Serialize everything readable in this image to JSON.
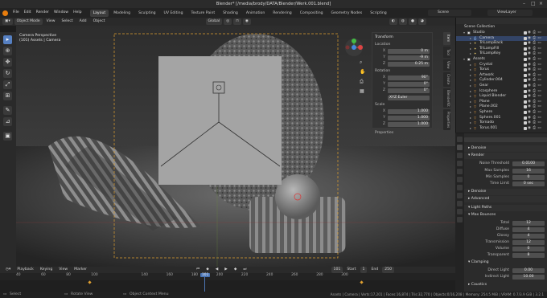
{
  "window": {
    "title": "Blender* [/media/brody/DATA/Blender/Werk.001.blend]"
  },
  "menu": [
    "File",
    "Edit",
    "Render",
    "Window",
    "Help"
  ],
  "workspaces": [
    "Layout",
    "Modeling",
    "Sculpting",
    "UV Editing",
    "Texture Paint",
    "Shading",
    "Animation",
    "Rendering",
    "Compositing",
    "Geometry Nodes",
    "Scripting"
  ],
  "active_workspace": "Layout",
  "scene": {
    "name": "Scene",
    "view_layer": "ViewLayer"
  },
  "header": {
    "mode": "Object Mode",
    "view": "View",
    "select": "Select",
    "add": "Add",
    "object": "Object",
    "orientation": "Global",
    "options": "Options"
  },
  "viewport": {
    "perspective": "Camera Perspective",
    "collection": "(101) Assets | Camera"
  },
  "npanel": {
    "title": "Transform",
    "location_label": "Location",
    "location": [
      {
        "axis": "X",
        "value": "0 m"
      },
      {
        "axis": "Y",
        "value": "-9 m"
      },
      {
        "axis": "Z",
        "value": "0.25 m"
      }
    ],
    "rotation_label": "Rotation",
    "rotation": [
      {
        "axis": "X",
        "value": "90°"
      },
      {
        "axis": "Y",
        "value": "0°"
      },
      {
        "axis": "Z",
        "value": "0°"
      }
    ],
    "euler": "XYZ Euler",
    "scale_label": "Scale",
    "scale": [
      {
        "axis": "X",
        "value": "1.000"
      },
      {
        "axis": "Y",
        "value": "1.000"
      },
      {
        "axis": "Z",
        "value": "1.000"
      }
    ],
    "properties": "Properties",
    "tabs": [
      "Item",
      "Tool",
      "View",
      "Create",
      "BlenderKit",
      "Properties"
    ]
  },
  "outliner": {
    "root": "Scene Collection",
    "items": [
      {
        "name": "Studio",
        "depth": 1,
        "type": "collection"
      },
      {
        "name": "Camera",
        "depth": 2,
        "type": "camera"
      },
      {
        "name": "TriLampBack",
        "depth": 2,
        "type": "light"
      },
      {
        "name": "TriLampFill",
        "depth": 2,
        "type": "light"
      },
      {
        "name": "TriLampKey",
        "depth": 2,
        "type": "light"
      },
      {
        "name": "Assets",
        "depth": 1,
        "type": "collection"
      },
      {
        "name": "Crystal",
        "depth": 2,
        "type": "mesh"
      },
      {
        "name": "Torus",
        "depth": 2,
        "type": "mesh"
      },
      {
        "name": "Artwork",
        "depth": 2,
        "type": "mesh"
      },
      {
        "name": "Cylinder.004",
        "depth": 2,
        "type": "mesh"
      },
      {
        "name": "Gear",
        "depth": 2,
        "type": "mesh"
      },
      {
        "name": "Icosphere",
        "depth": 2,
        "type": "mesh"
      },
      {
        "name": "Liquid Blender",
        "depth": 2,
        "type": "mesh"
      },
      {
        "name": "Plane",
        "depth": 2,
        "type": "mesh"
      },
      {
        "name": "Plane.002",
        "depth": 2,
        "type": "mesh"
      },
      {
        "name": "Sphere",
        "depth": 2,
        "type": "mesh"
      },
      {
        "name": "Sphere.001",
        "depth": 2,
        "type": "mesh"
      },
      {
        "name": "Tornado",
        "depth": 2,
        "type": "mesh"
      },
      {
        "name": "Torus.001",
        "depth": 2,
        "type": "mesh"
      }
    ]
  },
  "properties": {
    "denoise": "Denoise",
    "render_header": "Render",
    "noise_threshold": {
      "label": "Noise Threshold",
      "value": "0.0100"
    },
    "max_samples": {
      "label": "Max Samples",
      "value": "16"
    },
    "min_samples": {
      "label": "Min Samples",
      "value": "0"
    },
    "time_limit": {
      "label": "Time Limit",
      "value": "0 sec"
    },
    "denoise2": "Denoise",
    "advanced": "Advanced",
    "light_paths": "Light Paths",
    "max_bounces": "Max Bounces",
    "bounces": [
      {
        "label": "Total",
        "value": "12"
      },
      {
        "label": "Diffuse",
        "value": "4"
      },
      {
        "label": "Glossy",
        "value": "4"
      },
      {
        "label": "Transmission",
        "value": "12"
      },
      {
        "label": "Volume",
        "value": "0"
      },
      {
        "label": "Transparent",
        "value": "8"
      }
    ],
    "clamping": "Clamping",
    "direct_light": {
      "label": "Direct Light",
      "value": "0.00"
    },
    "indirect_light": {
      "label": "Indirect Light",
      "value": "10.00"
    },
    "caustics": "Caustics"
  },
  "timeline": {
    "playback": "Playback",
    "keying": "Keying",
    "view": "View",
    "marker": "Marker",
    "current_frame": "101",
    "start_label": "Start",
    "start": "1",
    "end_label": "End",
    "end": "250",
    "ticks": [
      "40",
      "60",
      "80",
      "100",
      "140",
      "160",
      "180",
      "200",
      "220",
      "240",
      "260",
      "280",
      "300"
    ],
    "cursor": "101"
  },
  "status": {
    "select": "Select",
    "rotate": "Rotate View",
    "context": "Object Context Menu",
    "stats": "Assets | Camera | Verts:17,201 | Faces:16,874 | Tris:32,770 | Objects:0/16,208 | Memory: 254.5 MiB | VRAM: 0.7/3.9 GiB | 3.2.1"
  },
  "colors": {
    "accent": "#e87d0d",
    "selection": "#5680c2",
    "camera_frame": "#e0a030"
  }
}
